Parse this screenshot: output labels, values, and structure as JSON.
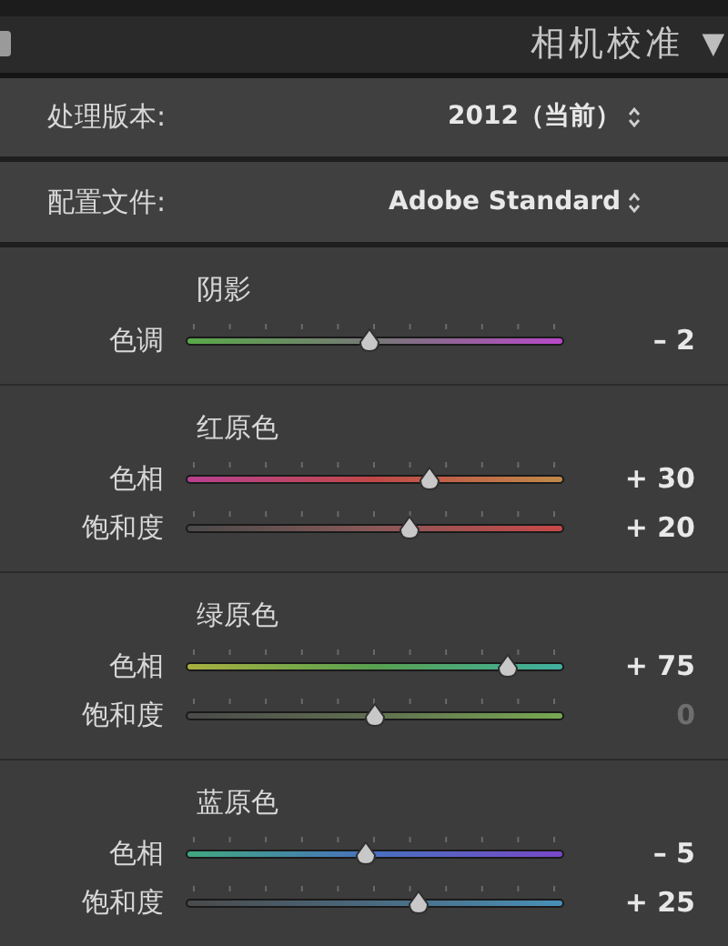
{
  "panel": {
    "title": "相机校准",
    "collapse_glyph": "▼"
  },
  "settings": [
    {
      "label": "处理版本:",
      "value": "2012（当前）"
    },
    {
      "label": "配置文件:",
      "value": "Adobe Standard"
    }
  ],
  "sections": [
    {
      "title": "阴影",
      "sliders": [
        {
          "label": "色调",
          "level": 0.485,
          "reading": "– 2",
          "muted": false
        }
      ]
    },
    {
      "title": "红原色",
      "sliders": [
        {
          "label": "色相",
          "level": 0.645,
          "reading": "+ 30",
          "muted": false
        },
        {
          "label": "饱和度",
          "level": 0.59,
          "reading": "+ 20",
          "muted": false
        }
      ]
    },
    {
      "title": "绿原色",
      "sliders": [
        {
          "label": "色相",
          "level": 0.85,
          "reading": "+ 75",
          "muted": false
        },
        {
          "label": "饱和度",
          "level": 0.5,
          "reading": "0",
          "muted": true
        }
      ]
    },
    {
      "title": "蓝原色",
      "sliders": [
        {
          "label": "色相",
          "level": 0.475,
          "reading": "– 5",
          "muted": false
        },
        {
          "label": "饱和度",
          "level": 0.615,
          "reading": "+ 25",
          "muted": false
        }
      ]
    }
  ]
}
